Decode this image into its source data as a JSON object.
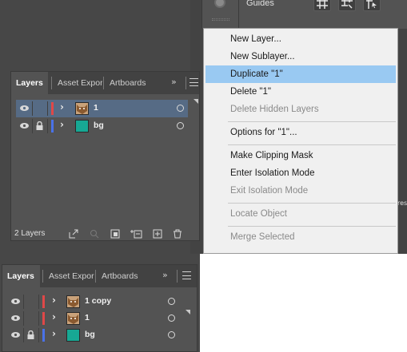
{
  "top_strip": {
    "guides_label": "Guides",
    "buttons": [
      "grid-icon",
      "snap-grid-icon",
      "snap-point-icon"
    ]
  },
  "panel_top": {
    "tabs": [
      {
        "label": "Layers",
        "active": true
      },
      {
        "label": "Asset Expor",
        "active": false
      },
      {
        "label": "Artboards",
        "active": false
      }
    ],
    "more_label": "»",
    "layers": [
      {
        "name": "1",
        "color": "#e04848",
        "thumb": "cat",
        "locked": false,
        "selected": true
      },
      {
        "name": "bg",
        "color": "#4a72e8",
        "thumb": "teal",
        "locked": true,
        "selected": false
      }
    ],
    "footer_count": "2 Layers"
  },
  "panel_bottom": {
    "tabs": [
      {
        "label": "Layers",
        "active": true
      },
      {
        "label": "Asset Expor",
        "active": false
      },
      {
        "label": "Artboards",
        "active": false
      }
    ],
    "more_label": "»",
    "layers": [
      {
        "name": "1 copy",
        "color": "#e04848",
        "thumb": "cat",
        "locked": false
      },
      {
        "name": "1",
        "color": "#e04848",
        "thumb": "cat",
        "locked": false
      },
      {
        "name": "bg",
        "color": "#4a72e8",
        "thumb": "teal",
        "locked": true
      }
    ]
  },
  "context_menu": {
    "items": [
      {
        "label": "New Layer...",
        "enabled": true,
        "highlighted": false
      },
      {
        "label": "New Sublayer...",
        "enabled": true,
        "highlighted": false
      },
      {
        "label": "Duplicate \"1\"",
        "enabled": true,
        "highlighted": true
      },
      {
        "label": "Delete \"1\"",
        "enabled": true,
        "highlighted": false
      },
      {
        "label": "Delete Hidden Layers",
        "enabled": false,
        "highlighted": false
      },
      {
        "label": "Options for \"1\"...",
        "enabled": true,
        "highlighted": false
      },
      {
        "label": "Make Clipping Mask",
        "enabled": true,
        "highlighted": false
      },
      {
        "label": "Enter Isolation Mode",
        "enabled": true,
        "highlighted": false
      },
      {
        "label": "Exit Isolation Mode",
        "enabled": false,
        "highlighted": false
      },
      {
        "label": "Locate Object",
        "enabled": false,
        "highlighted": false
      },
      {
        "label": "Merge Selected",
        "enabled": false,
        "highlighted": false
      }
    ]
  },
  "right_snippet": "res",
  "colors": {
    "highlight": "#99c9f2",
    "selected_row": "#566b85",
    "red_layer": "#e04848",
    "blue_layer": "#4a72e8"
  }
}
